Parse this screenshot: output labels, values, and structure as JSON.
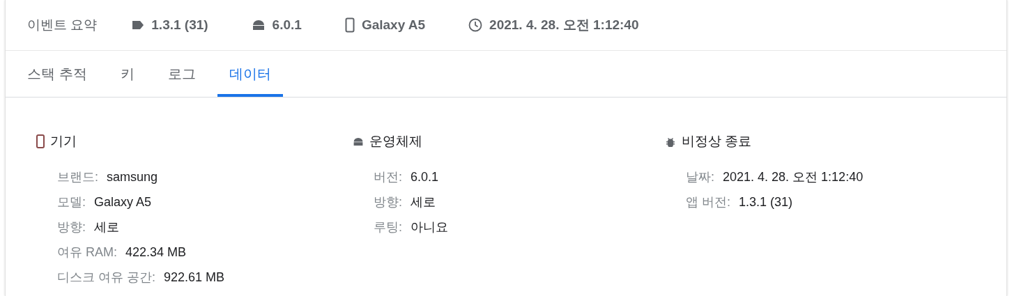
{
  "summary": {
    "title": "이벤트 요약",
    "items": [
      {
        "kind": "tag",
        "text": "1.3.1 (31)"
      },
      {
        "kind": "android",
        "text": "6.0.1"
      },
      {
        "kind": "phone",
        "text": "Galaxy A5"
      },
      {
        "kind": "clock",
        "text": "2021. 4. 28. 오전 1:12:40"
      }
    ]
  },
  "tabs": [
    {
      "label": "스택 추적",
      "selected": false
    },
    {
      "label": "키",
      "selected": false
    },
    {
      "label": "로그",
      "selected": false
    },
    {
      "label": "데이터",
      "selected": true
    }
  ],
  "sections": [
    {
      "kind": "phone",
      "title": "기기",
      "rows": [
        {
          "label": "브랜드:",
          "value": "samsung"
        },
        {
          "label": "모델:",
          "value": "Galaxy A5"
        },
        {
          "label": "방향:",
          "value": "세로"
        },
        {
          "label": "여유 RAM:",
          "value": "422.34 MB"
        },
        {
          "label": "디스크 여유 공간:",
          "value": "922.61 MB"
        }
      ]
    },
    {
      "kind": "android",
      "title": "운영체제",
      "rows": [
        {
          "label": "버전:",
          "value": "6.0.1"
        },
        {
          "label": "방향:",
          "value": "세로"
        },
        {
          "label": "루팅:",
          "value": "아니요"
        }
      ]
    },
    {
      "kind": "bug",
      "title": "비정상 종료",
      "rows": [
        {
          "label": "날짜:",
          "value": "2021. 4. 28. 오전 1:12:40"
        },
        {
          "label": "앱 버전:",
          "value": "1.3.1 (31)"
        }
      ]
    }
  ]
}
